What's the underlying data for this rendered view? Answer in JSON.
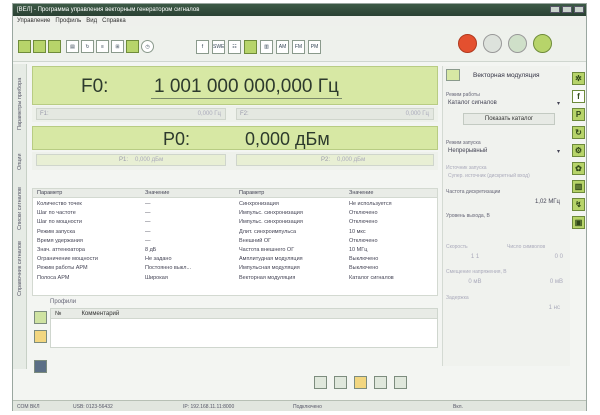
{
  "window": {
    "title": "[ВЕЛ] - Программа управления векторным генератором сигналов"
  },
  "menu": [
    "Управление",
    "Профиль",
    "Вид",
    "Справка"
  ],
  "toolbar": {
    "left_icons": [
      "home-icon",
      "play-icon",
      "save-icon",
      "print-icon",
      "loop-icon",
      "list-icon",
      "network-icon",
      "chart-icon",
      "clock-icon"
    ],
    "mid_labels": [
      "f",
      "SWE",
      "",
      "",
      "",
      "AM",
      "FM",
      "PM"
    ],
    "right_icons": [
      "power-icon",
      "ref-icon",
      "settings-icon",
      "rf-icon"
    ]
  },
  "left_tabs": [
    "Параметры прибора",
    "Опции",
    "Списки сигналов",
    "Справочник сигналов"
  ],
  "freq": {
    "label": "F0:",
    "value": "1 001 000 000,000 Гц",
    "f1_label": "F1:",
    "f1_value": "0,000 Гц",
    "f2_label": "F2:",
    "f2_value": "0,000 Гц"
  },
  "power": {
    "label": "P0:",
    "value": "0,000 дБм",
    "p1_label": "P1:",
    "p1_value": "0,000 дБм",
    "p2_label": "P2:",
    "p2_value": "0,000 дБм"
  },
  "params_table": {
    "headers": [
      "Параметр",
      "Значение",
      "Параметр",
      "Значение"
    ],
    "left_names": [
      "Количество точек",
      "Шаг по частоте",
      "Шаг по мощности",
      "Режим запуска",
      "Время удержания",
      "Знач. аттенюатора",
      "Ограничение мощности",
      "Режим работы АРМ",
      "Полоса АРМ"
    ],
    "left_values": [
      "—",
      "—",
      "—",
      "—",
      "—",
      "8 дБ",
      "Не задано",
      "Постоянно выкл...",
      "Широкая"
    ],
    "right_names": [
      "Синхронизация",
      "Импульс. синхронизация",
      "Импульс. синхронизация",
      "Длит. синхроимпульса",
      "Внешний ОГ",
      "Частота внешнего ОГ",
      "Амплитудная модуляция",
      "Импульсная модуляция",
      "Векторная модуляция"
    ],
    "right_values": [
      "Не используется",
      "Отключено",
      "Отключено",
      "10 мкс",
      "Отключено",
      "10 МГц",
      "Выключено",
      "Выключено",
      "Каталог сигналов"
    ]
  },
  "profiles": {
    "title": "Профили",
    "col_num": "№",
    "col_comment": "Комментарий"
  },
  "right_panel": {
    "title": "Векторная модуляция",
    "mode_label": "Режим работы",
    "mode_value": "Каталог сигналов",
    "show_catalog": "Показать каталог",
    "trigger_label": "Режим запуска",
    "trigger_value": "Непрерывный",
    "trigger_source_label": "Источник запуска",
    "trigger_source_value": "Супер. источник (дискретный вход)",
    "sample_rate_label": "Частота дискретизации",
    "sample_rate_value": "1,02 МГц",
    "level_label": "Уровень выхода, В",
    "level_value": "",
    "field_a_label": "Скорость",
    "field_a_value": "1 1",
    "field_b_label": "Число символов",
    "field_b_value": "0 0",
    "offset_label": "Смещение напряжения, В",
    "offset_value_1": "0 мВ",
    "offset_value_2": "0 мВ",
    "delay_label": "Задержка",
    "delay_value": "1 нс"
  },
  "right_tools": [
    "clear-icon",
    "f-icon",
    "P-icon",
    "refresh-icon",
    "gear-icon",
    "chart-icon",
    "bars-icon",
    "pulse-icon",
    "display-icon"
  ],
  "statusbar": {
    "status": "СОМ ВКЛ",
    "port": "USB: 0123-56432",
    "ip": "IP: 192.168.11.11:8000",
    "mode": "Подключено",
    "ready": "Вкл."
  },
  "colors": {
    "accent_green": "#b7d46a",
    "panel_green": "#d7e8a4",
    "title_dark": "#2a4133"
  }
}
